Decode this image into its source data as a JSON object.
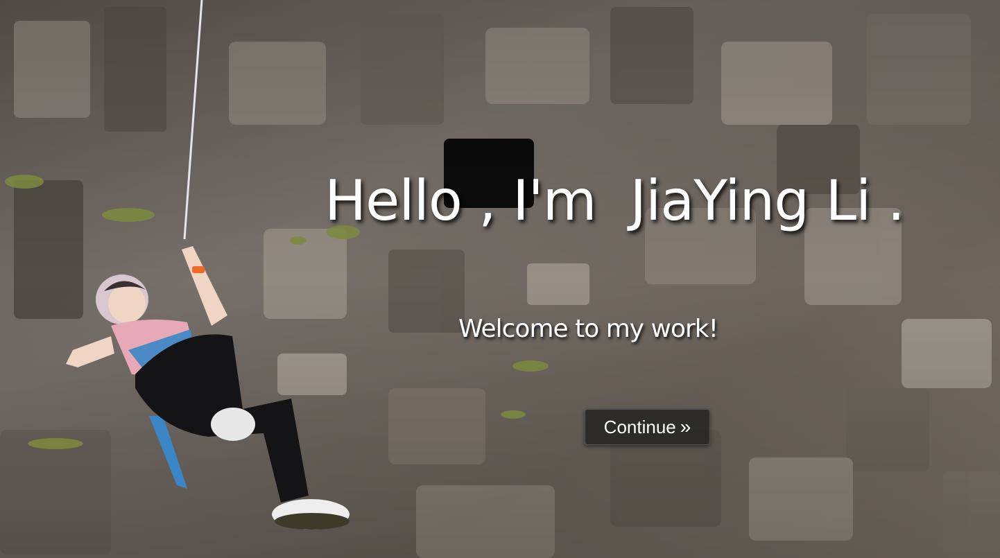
{
  "hero": {
    "title": "Hello , I'm  JiaYing Li .",
    "subtitle": "Welcome to my work!",
    "continue_button": {
      "label": "Continue",
      "icon": "chevron-double-right-icon",
      "glyph": "»"
    }
  },
  "colors": {
    "text": "#ffffff",
    "button_bg": "#262626",
    "rock": "#6f675f"
  }
}
